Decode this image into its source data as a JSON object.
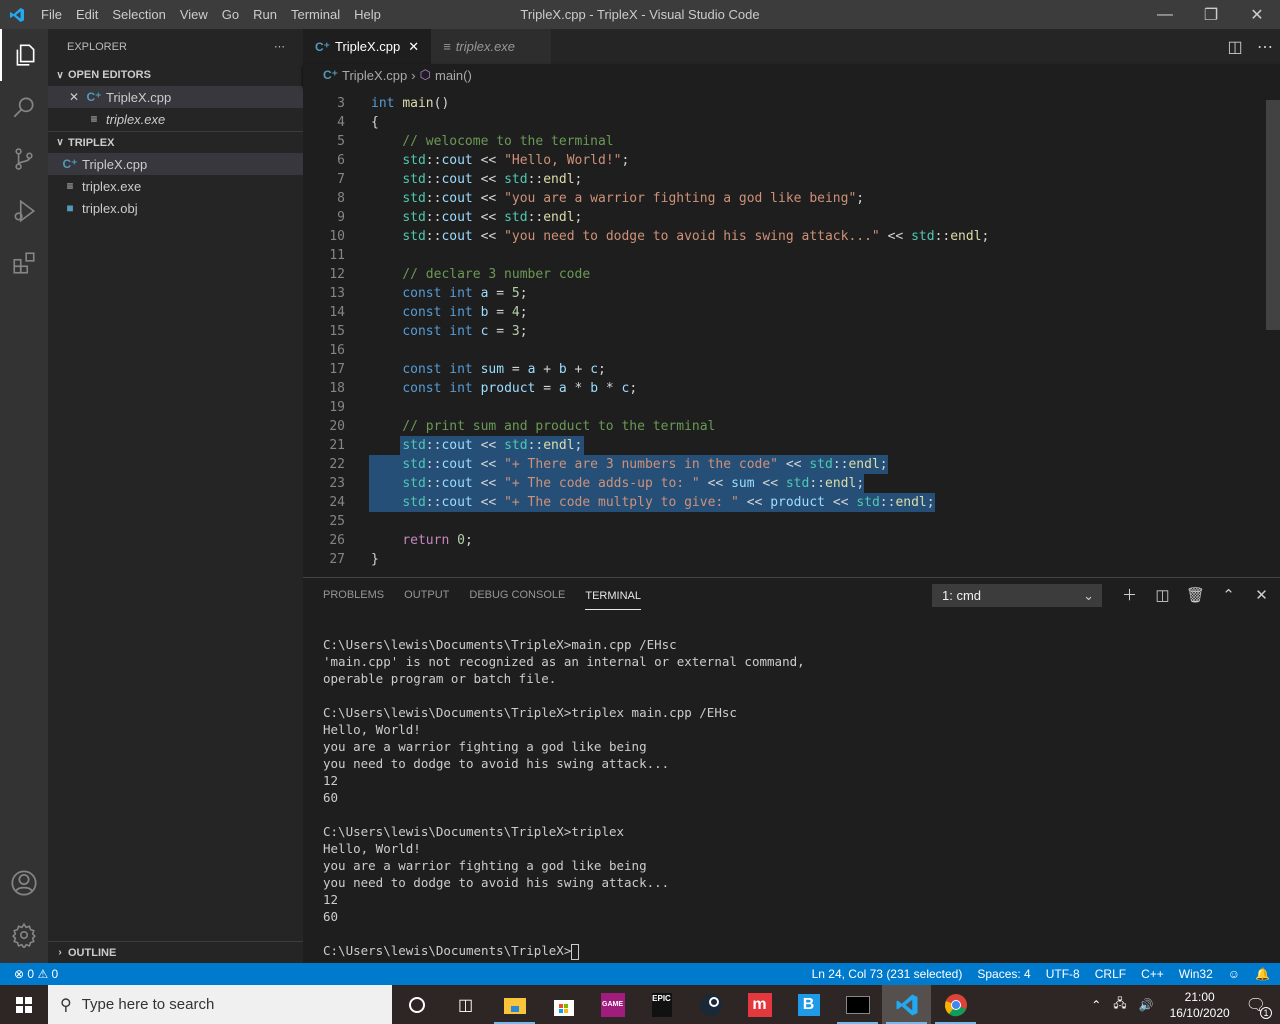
{
  "window": {
    "title": "TripleX.cpp - TripleX - Visual Studio Code",
    "menu": [
      "File",
      "Edit",
      "Selection",
      "View",
      "Go",
      "Run",
      "Terminal",
      "Help"
    ]
  },
  "activity_icons": [
    "explorer-icon",
    "search-icon",
    "source-control-icon",
    "run-debug-icon",
    "extensions-icon"
  ],
  "sidebar": {
    "header": "EXPLORER",
    "open_editors_label": "OPEN EDITORS",
    "open_editors": [
      {
        "name": "TripleX.cpp"
      },
      {
        "name": "triplex.exe"
      }
    ],
    "folder_label": "TRIPLEX",
    "files": [
      {
        "name": "TripleX.cpp"
      },
      {
        "name": "triplex.exe"
      },
      {
        "name": "triplex.obj"
      }
    ],
    "outline_label": "OUTLINE"
  },
  "tabs": [
    {
      "label": "TripleX.cpp",
      "active": true
    },
    {
      "label": "triplex.exe",
      "active": false
    }
  ],
  "breadcrumb": {
    "file": "TripleX.cpp",
    "symbol": "main()"
  },
  "code": [
    {
      "n": "3",
      "t": "int main()"
    },
    {
      "n": "4",
      "t": "{"
    },
    {
      "n": "5",
      "t": "    // welocome to the terminal"
    },
    {
      "n": "6",
      "t": "    std::cout << \"Hello, World!\";"
    },
    {
      "n": "7",
      "t": "    std::cout << std::endl;"
    },
    {
      "n": "8",
      "t": "    std::cout << \"you are a warrior fighting a god like being\";"
    },
    {
      "n": "9",
      "t": "    std::cout << std::endl;"
    },
    {
      "n": "10",
      "t": "    std::cout << \"you need to dodge to avoid his swing attack...\" << std::endl;"
    },
    {
      "n": "11",
      "t": ""
    },
    {
      "n": "12",
      "t": "    // declare 3 number code"
    },
    {
      "n": "13",
      "t": "    const int a = 5;"
    },
    {
      "n": "14",
      "t": "    const int b = 4;"
    },
    {
      "n": "15",
      "t": "    const int c = 3;"
    },
    {
      "n": "16",
      "t": ""
    },
    {
      "n": "17",
      "t": "    const int sum = a + b + c;"
    },
    {
      "n": "18",
      "t": "    const int product = a * b * c;"
    },
    {
      "n": "19",
      "t": ""
    },
    {
      "n": "20",
      "t": "    // print sum and product to the terminal"
    },
    {
      "n": "21",
      "t": "    std::cout << std::endl;"
    },
    {
      "n": "22",
      "t": "    std::cout << \"+ There are 3 numbers in the code\" << std::endl;"
    },
    {
      "n": "23",
      "t": "    std::cout << \"+ The code adds-up to: \" << sum << std::endl;"
    },
    {
      "n": "24",
      "t": "    std::cout << \"+ The code multply to give: \" << product << std::endl;"
    },
    {
      "n": "25",
      "t": ""
    },
    {
      "n": "26",
      "t": "    return 0;"
    },
    {
      "n": "27",
      "t": "}"
    }
  ],
  "panel": {
    "tabs": [
      "PROBLEMS",
      "OUTPUT",
      "DEBUG CONSOLE",
      "TERMINAL"
    ],
    "active_tab": "TERMINAL",
    "terminal_select": "1: cmd",
    "terminal_lines": [
      "C:\\Users\\lewis\\Documents\\TripleX>main.cpp /EHsc",
      "'main.cpp' is not recognized as an internal or external command,",
      "operable program or batch file.",
      "",
      "C:\\Users\\lewis\\Documents\\TripleX>triplex main.cpp /EHsc",
      "Hello, World!",
      "you are a warrior fighting a god like being",
      "you need to dodge to avoid his swing attack...",
      "12",
      "60",
      "",
      "C:\\Users\\lewis\\Documents\\TripleX>triplex",
      "Hello, World!",
      "you are a warrior fighting a god like being",
      "you need to dodge to avoid his swing attack...",
      "12",
      "60",
      "",
      "C:\\Users\\lewis\\Documents\\TripleX>"
    ]
  },
  "status": {
    "errors": "0",
    "warnings": "0",
    "position": "Ln 24, Col 73 (231 selected)",
    "spaces": "Spaces: 4",
    "encoding": "UTF-8",
    "eol": "CRLF",
    "language": "C++",
    "platform": "Win32"
  },
  "taskbar": {
    "search_placeholder": "Type here to search",
    "time": "21:00",
    "date": "16/10/2020",
    "notifications": "1"
  }
}
